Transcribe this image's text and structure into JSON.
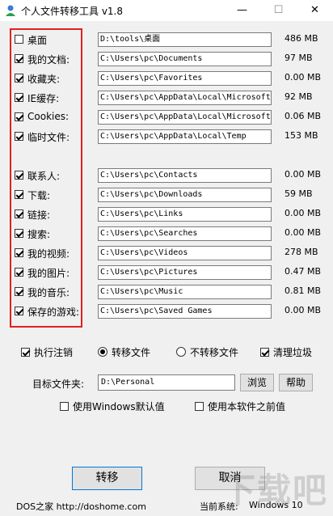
{
  "window": {
    "title": "个人文件转移工具 v1.8",
    "minimize": "—",
    "maximize": "☐",
    "close": "✕"
  },
  "rows": [
    {
      "label": "桌面",
      "path": "D:\\tools\\桌面",
      "size": "486 MB",
      "checked": false
    },
    {
      "label": "我的文档:",
      "path": "C:\\Users\\pc\\Documents",
      "size": "97 MB",
      "checked": true
    },
    {
      "label": "收藏夹:",
      "path": "C:\\Users\\pc\\Favorites",
      "size": "0.00 MB",
      "checked": true
    },
    {
      "label": "IE缓存:",
      "path": "C:\\Users\\pc\\AppData\\Local\\Microsoft\\",
      "size": "92 MB",
      "checked": true
    },
    {
      "label": "Cookies:",
      "path": "C:\\Users\\pc\\AppData\\Local\\Microsoft\\",
      "size": "0.06 MB",
      "checked": true
    },
    {
      "label": "临时文件:",
      "path": "C:\\Users\\pc\\AppData\\Local\\Temp",
      "size": "153 MB",
      "checked": true
    },
    {
      "label": "联系人:",
      "path": "C:\\Users\\pc\\Contacts",
      "size": "0.00 MB",
      "checked": true
    },
    {
      "label": "下载:",
      "path": "C:\\Users\\pc\\Downloads",
      "size": "59 MB",
      "checked": true
    },
    {
      "label": "链接:",
      "path": "C:\\Users\\pc\\Links",
      "size": "0.00 MB",
      "checked": true
    },
    {
      "label": "搜索:",
      "path": "C:\\Users\\pc\\Searches",
      "size": "0.00 MB",
      "checked": true
    },
    {
      "label": "我的视频:",
      "path": "C:\\Users\\pc\\Videos",
      "size": "278 MB",
      "checked": true
    },
    {
      "label": "我的图片:",
      "path": "C:\\Users\\pc\\Pictures",
      "size": "0.47 MB",
      "checked": true
    },
    {
      "label": "我的音乐:",
      "path": "C:\\Users\\pc\\Music",
      "size": "0.81 MB",
      "checked": true
    },
    {
      "label": "保存的游戏:",
      "path": "C:\\Users\\pc\\Saved Games",
      "size": "0.00 MB",
      "checked": true
    }
  ],
  "options": {
    "run_logoff": "执行注销",
    "run_logoff_checked": true,
    "mode_transfer": "转移文件",
    "mode_transfer_selected": true,
    "mode_no_transfer": "不转移文件",
    "clean_junk": "清理垃圾",
    "clean_junk_checked": true
  },
  "target": {
    "label": "目标文件夹:",
    "value": "D:\\Personal",
    "browse": "浏览",
    "help": "帮助"
  },
  "defaults": {
    "windows_default": "使用Windows默认值",
    "previous_value": "使用本软件之前值"
  },
  "actions": {
    "transfer": "转移",
    "cancel": "取消"
  },
  "footer": {
    "brand": "DOS之家 http://doshome.com",
    "system_label": "当前系统:",
    "system_value": "Windows 10"
  },
  "watermark": "下载吧",
  "colors": {
    "highlight_box": "#e02020"
  }
}
